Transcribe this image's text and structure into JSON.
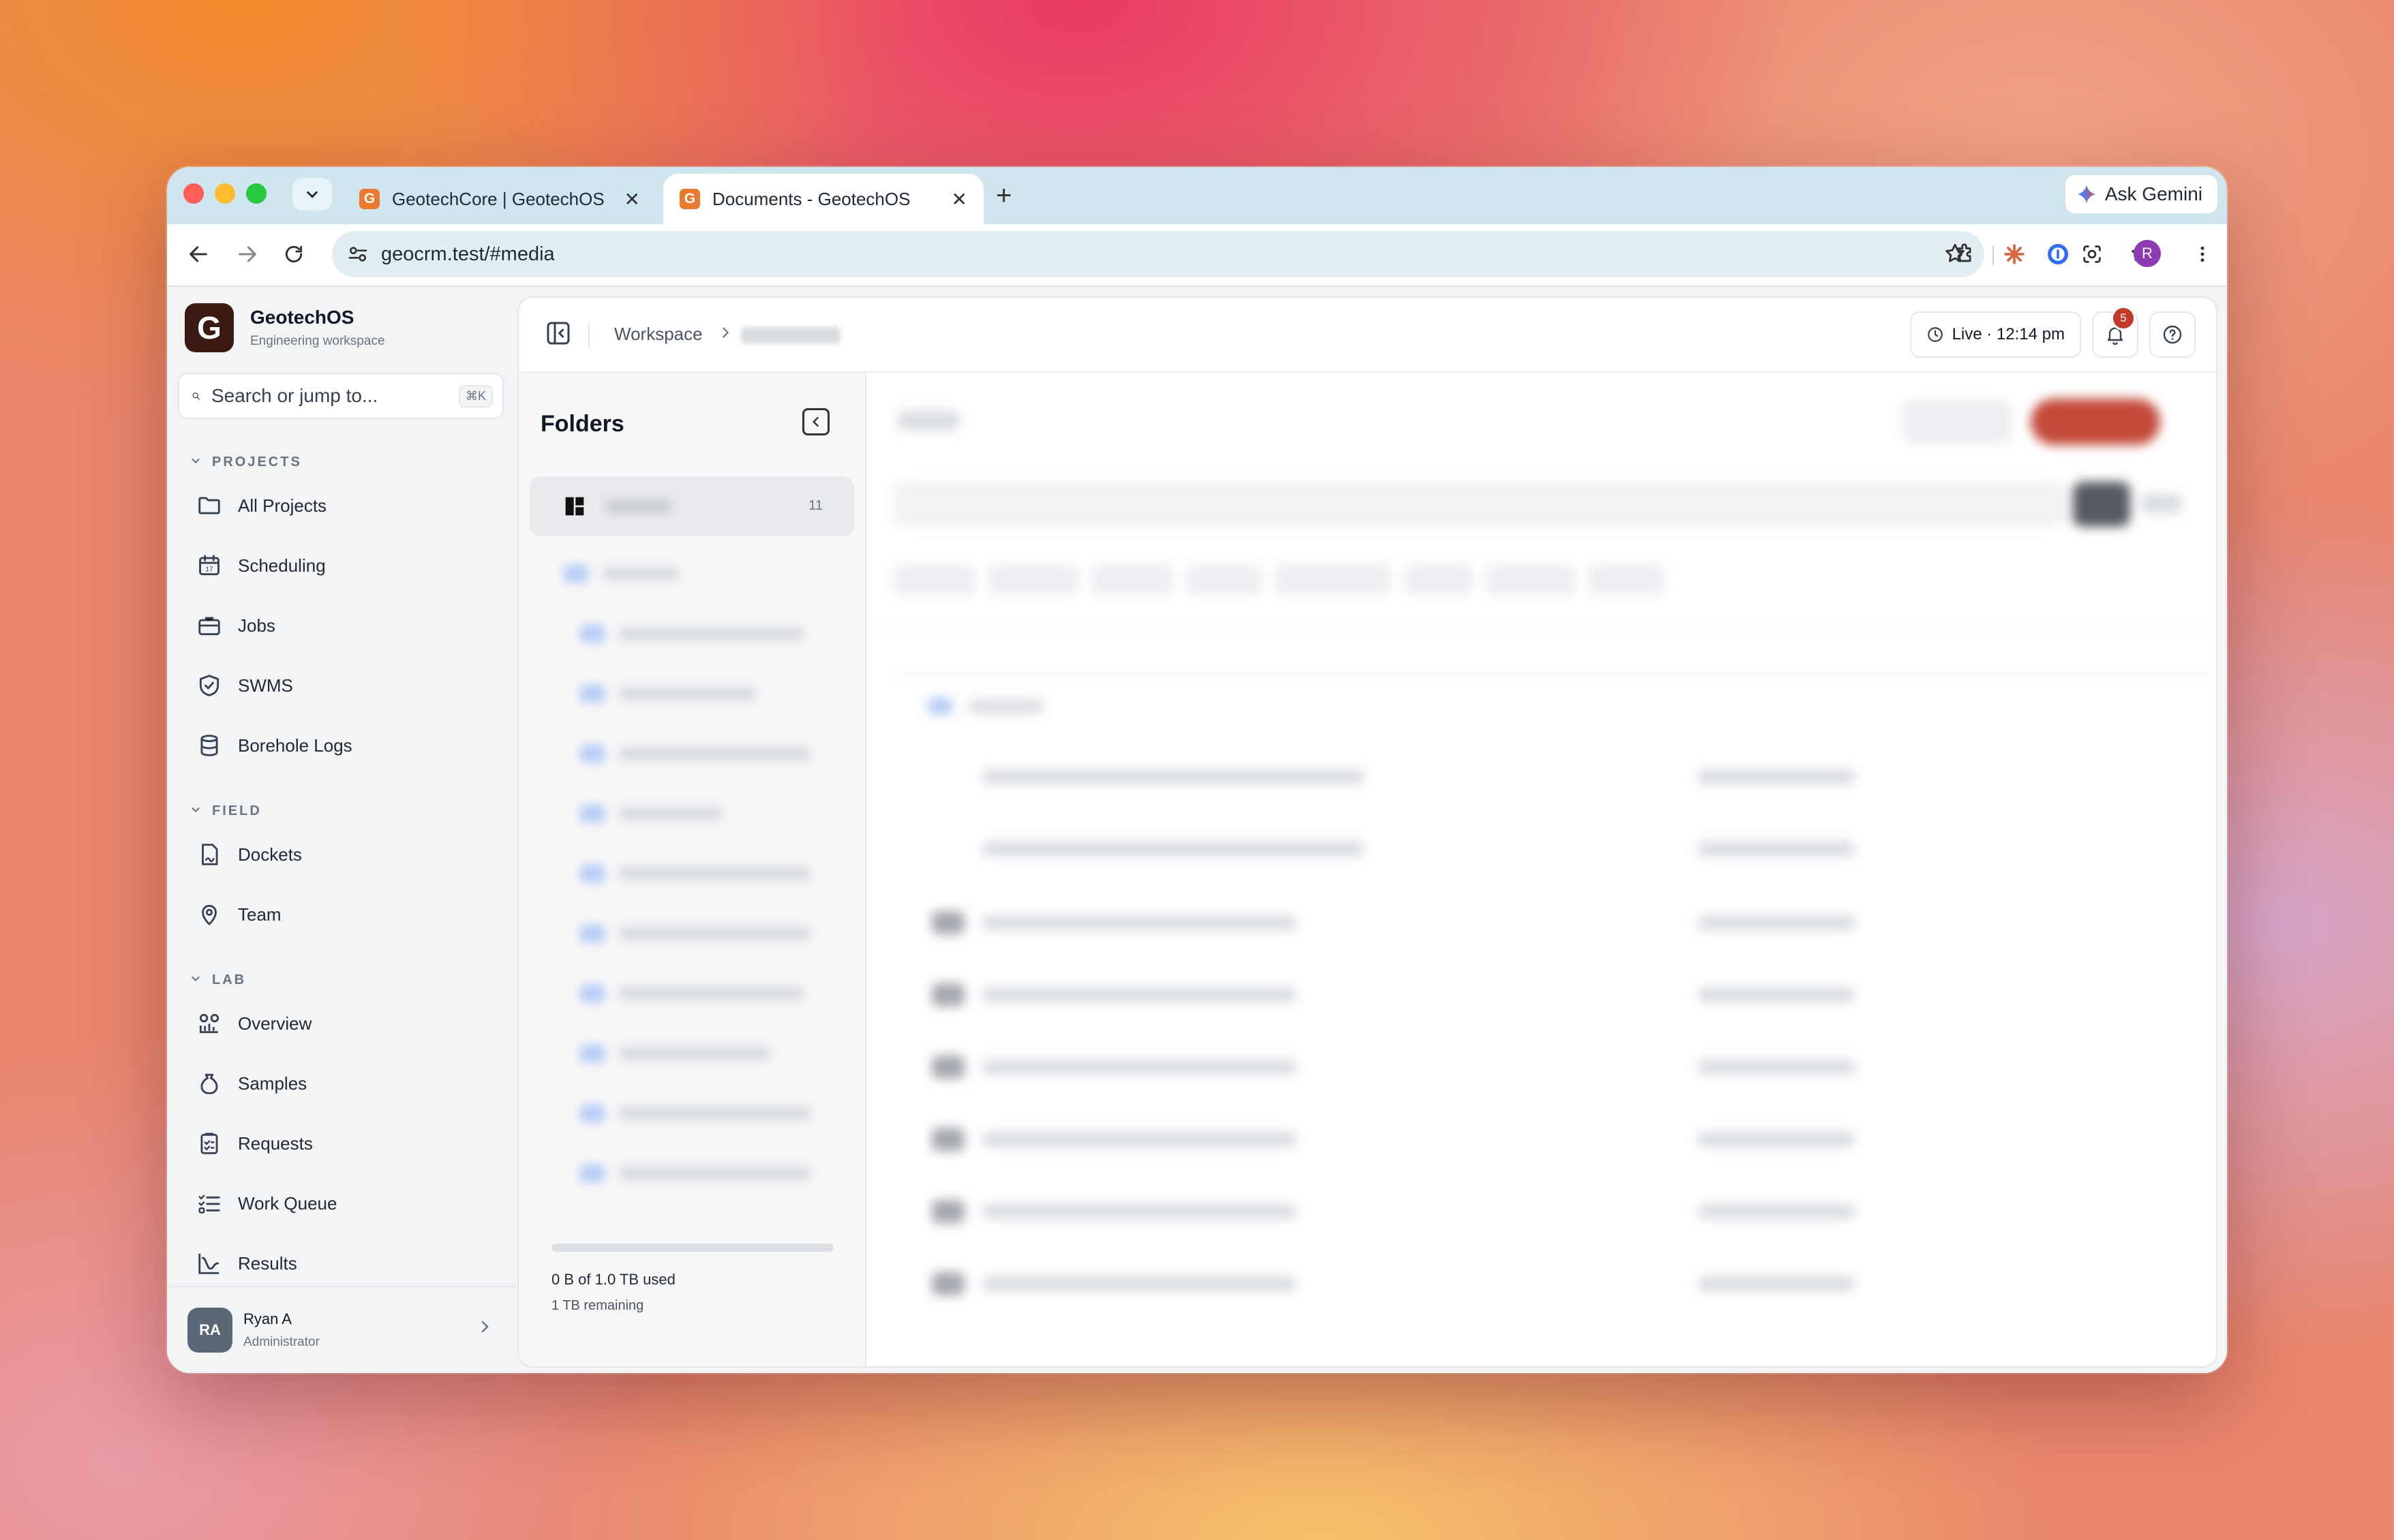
{
  "browser": {
    "tabs": [
      {
        "favicon": "G",
        "title": "GeotechCore | GeotechOS"
      },
      {
        "favicon": "G",
        "title": "Documents - GeotechOS"
      }
    ],
    "new_tab_label": "+",
    "gemini_label": "Ask Gemini",
    "url": "geocrm.test/#media",
    "profile_initial": "R"
  },
  "app": {
    "brand": {
      "logo": "G",
      "name": "GeotechOS",
      "subtitle": "Engineering workspace"
    },
    "search": {
      "placeholder": "Search or jump to...",
      "shortcut": "⌘K"
    },
    "sections": [
      {
        "title": "PROJECTS",
        "items": [
          {
            "label": "All Projects",
            "icon": "folder-icon"
          },
          {
            "label": "Scheduling",
            "icon": "calendar-icon"
          },
          {
            "label": "Jobs",
            "icon": "briefcase-icon"
          },
          {
            "label": "SWMS",
            "icon": "shield-icon"
          },
          {
            "label": "Borehole Logs",
            "icon": "database-icon"
          }
        ]
      },
      {
        "title": "FIELD",
        "items": [
          {
            "label": "Dockets",
            "icon": "docket-icon"
          },
          {
            "label": "Team",
            "icon": "map-pin-icon"
          }
        ]
      },
      {
        "title": "LAB",
        "items": [
          {
            "label": "Overview",
            "icon": "overview-icon"
          },
          {
            "label": "Samples",
            "icon": "sample-bag-icon"
          },
          {
            "label": "Requests",
            "icon": "clipboard-icon"
          },
          {
            "label": "Work Queue",
            "icon": "list-icon"
          },
          {
            "label": "Results",
            "icon": "chart-icon"
          }
        ]
      }
    ],
    "user": {
      "initials": "RA",
      "name": "Ryan A",
      "role": "Administrator"
    }
  },
  "topbar": {
    "breadcrumb_root": "Workspace",
    "live_label": "Live · 12:14 pm",
    "notification_count": "5"
  },
  "folders": {
    "title": "Folders",
    "all_count": "11",
    "storage_used_fraction": 0.0,
    "storage_used": "0 B of 1.0 TB used",
    "storage_remaining": "1 TB remaining"
  },
  "colors": {
    "accent": "#c0392b",
    "brand": "#3b1a12",
    "favicon": "#ea7a2f"
  }
}
